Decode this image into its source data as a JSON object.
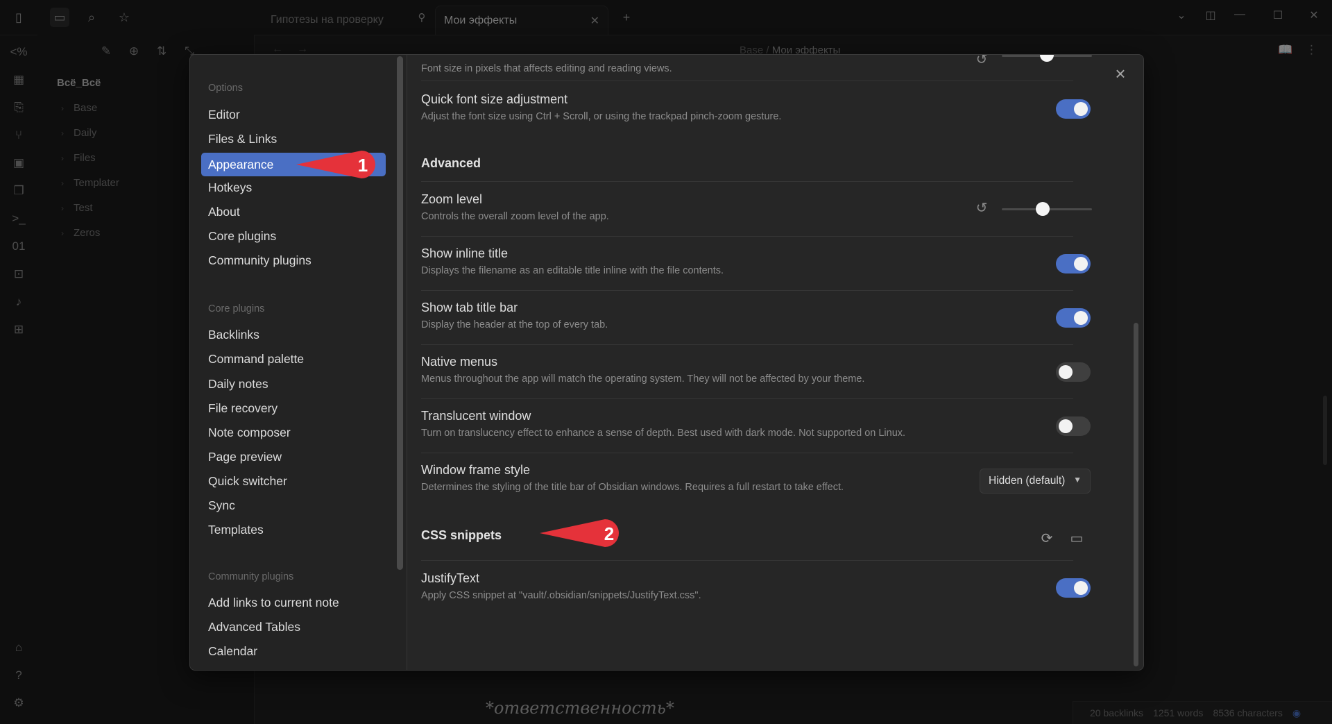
{
  "tabs": [
    {
      "label": "Гипотезы на проверку",
      "active": false
    },
    {
      "label": "Мои эффекты",
      "active": true
    }
  ],
  "breadcrumb": {
    "parent": "Base",
    "sep": "/",
    "current": "Мои эффекты"
  },
  "sidebar": {
    "vault_name": "Всё_Всё",
    "folders": [
      "Base",
      "Daily",
      "Files",
      "Templater",
      "Test",
      "Zeros"
    ]
  },
  "editor": {
    "bottom_text": "*ответственность*"
  },
  "status_bar": {
    "backlinks": "20 backlinks",
    "words": "1251 words",
    "characters": "8536 characters"
  },
  "settings": {
    "sections": {
      "options": "Options",
      "core_plugins": "Core plugins",
      "community_plugins": "Community plugins"
    },
    "options_items": [
      "Editor",
      "Files & Links",
      "Appearance",
      "Hotkeys",
      "About",
      "Core plugins",
      "Community plugins"
    ],
    "core_plugin_items": [
      "Backlinks",
      "Command palette",
      "Daily notes",
      "File recovery",
      "Note composer",
      "Page preview",
      "Quick switcher",
      "Sync",
      "Templates"
    ],
    "community_plugin_items": [
      "Add links to current note",
      "Advanced Tables",
      "Calendar"
    ],
    "active_item": "Appearance",
    "content": {
      "font_size_desc": "Font size in pixels that affects editing and reading views.",
      "font_size_slider_value": 0.5,
      "quick_font": {
        "title": "Quick font size adjustment",
        "desc": "Adjust the font size using Ctrl + Scroll, or using the trackpad pinch-zoom gesture.",
        "on": true
      },
      "advanced_title": "Advanced",
      "zoom": {
        "title": "Zoom level",
        "desc": "Controls the overall zoom level of the app.",
        "slider_value": 0.45
      },
      "inline_title": {
        "title": "Show inline title",
        "desc": "Displays the filename as an editable title inline with the file contents.",
        "on": true
      },
      "tab_title_bar": {
        "title": "Show tab title bar",
        "desc": "Display the header at the top of every tab.",
        "on": true
      },
      "native_menus": {
        "title": "Native menus",
        "desc": "Menus throughout the app will match the operating system. They will not be affected by your theme.",
        "on": false
      },
      "translucent": {
        "title": "Translucent window",
        "desc": "Turn on translucency effect to enhance a sense of depth. Best used with dark mode. Not supported on Linux.",
        "on": false
      },
      "frame_style": {
        "title": "Window frame style",
        "desc": "Determines the styling of the title bar of Obsidian windows. Requires a full restart to take effect.",
        "value": "Hidden (default)"
      },
      "css_snippets_title": "CSS snippets",
      "justify": {
        "title": "JustifyText",
        "desc": "Apply CSS snippet at \"vault/.obsidian/snippets/JustifyText.css\".",
        "on": true
      }
    }
  },
  "callouts": [
    {
      "label": "1"
    },
    {
      "label": "2"
    }
  ],
  "colors": {
    "accent": "#4a6fc4",
    "callout": "#e5323a",
    "background": "#1e1e1e",
    "modal": "#262626"
  }
}
